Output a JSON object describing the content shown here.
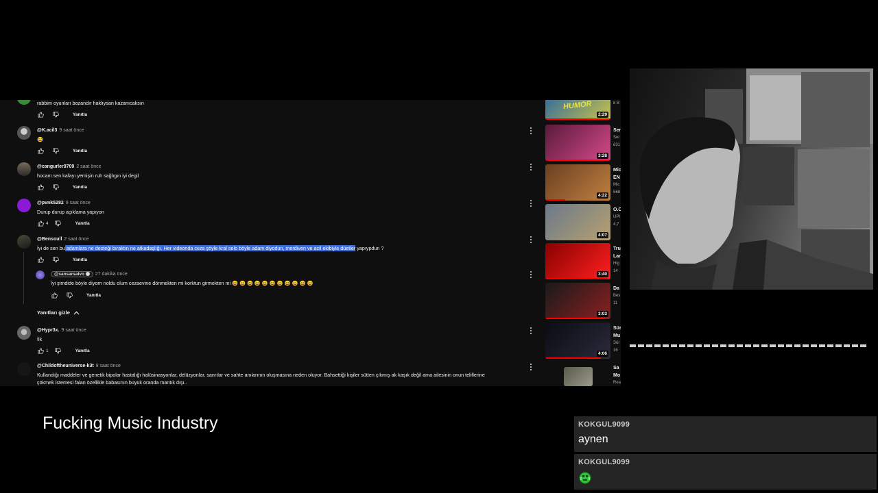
{
  "comments": [
    {
      "text": "rabbim oyunları bozandır haklıysan kazanıcaksın",
      "reply_label": "Yanıtla"
    },
    {
      "user": "@K.acil3",
      "time": "9 saat önce",
      "text": "😂",
      "reply_label": "Yanıtla"
    },
    {
      "user": "@cangurler9709",
      "time": "2 saat önce",
      "text": "hocam sen kafayı yemişin ruh sağlıgın iyi degil",
      "reply_label": "Yanıtla"
    },
    {
      "user": "@pvnk5282",
      "time": "9 saat önce",
      "text": "Durup durup açıklama yapıyon",
      "likes": "4",
      "reply_label": "Yanıtla"
    },
    {
      "user": "@Bensoull",
      "time": "2 saat önce",
      "text_pre": "İyi de sen bu",
      "text_highlight": " adamlara ne desteği bıraktın ne atkadaşlığı. Her videonda ceza şöyle kral selo böyle adam diyodun, merdiven ve acil ekibiyle düetler",
      "text_post": " yapıypdun ?",
      "reply_label": "Yanıtla"
    },
    {
      "user": "@sansarsalvo",
      "time": "27 dakika önce",
      "text": "İyi şimdide böyle diyorn noldu olum cezaevine dönmekten mi korktun girmekten mi 😄 😄 😄 😄 😄 😄 😄 😄 😄 😄 😄",
      "reply_label": "Yanıtla"
    },
    {
      "user": "@Hypr3x.",
      "time": "9 saat önce",
      "text": "İlk",
      "likes": "1",
      "reply_label": "Yanıtla"
    },
    {
      "user": "@Childoftheuniverse-k3t",
      "time": "9 saat önce",
      "text_line1": "Kullandığı maddeler ve genetik bipolar hastalığı halüsinasyonlar, delüzyonlar, sanrılar ve sahte anılarının oluşmasına neden oluyor. Bahsettiği kişiler sütten çıkmış ak kaşık değil ama ailesinin onun teliflerine",
      "text_line2": "çökmek istemesi falan özellikle babasının büyük oranda mantık dışı.."
    }
  ],
  "hide_replies_label": "Yanıtları gizle",
  "sidebar": [
    {
      "thumb_text": "HUMOR",
      "duration": "2:29",
      "meta1": "8 B",
      "color1": "#1e5fa8",
      "color2": "#c9c34a",
      "progress": 1.0
    },
    {
      "title": "Ser",
      "meta1": "Ser",
      "meta2": "631",
      "duration": "3:28",
      "color1": "#5a1a3a",
      "color2": "#d44a8a",
      "progress": 1.0
    },
    {
      "title": "Mic",
      "title2": "EN",
      "meta1": "Mic",
      "meta2": "568",
      "duration": "4:22",
      "color1": "#6a4020",
      "color2": "#c08040",
      "progress": 0.3
    },
    {
      "title": "O.C",
      "meta1": "UPI",
      "meta2": "4,7",
      "duration": "4:07",
      "color1": "#6a7a8a",
      "color2": "#b8a070",
      "progress": 0.0
    },
    {
      "title": "Tru",
      "title2": "Lar",
      "meta1": "Hig",
      "meta2": "14",
      "duration": "3:40",
      "color1": "#8a0000",
      "color2": "#ff2020",
      "progress": 0.95
    },
    {
      "title": "Da",
      "meta1": "Bes",
      "meta2": "11",
      "duration": "3:03",
      "color1": "#1a1a1a",
      "color2": "#8a2020",
      "progress": 0.9
    },
    {
      "title": "Sür",
      "title2": "Mu",
      "meta1": "Sür",
      "meta2": "16",
      "duration": "4:06",
      "color1": "#0c0c14",
      "color2": "#2a2a3a",
      "progress": 0.85
    },
    {
      "title": "Sa",
      "title2": "Mo",
      "meta1": "Rea",
      "color1": "#5a5a4a",
      "color2": "#9a9a8a",
      "progress": 0.0
    }
  ],
  "caption": "Fucking Music Industry",
  "chat": [
    {
      "user": "KOKGUL9099",
      "message": "aynen"
    },
    {
      "user": "KOKGUL9099",
      "emote": "green-emote"
    }
  ],
  "colors": {
    "highlight": "#3d6bd6",
    "progress": "#ff0000",
    "chat_bg": "#282828"
  }
}
